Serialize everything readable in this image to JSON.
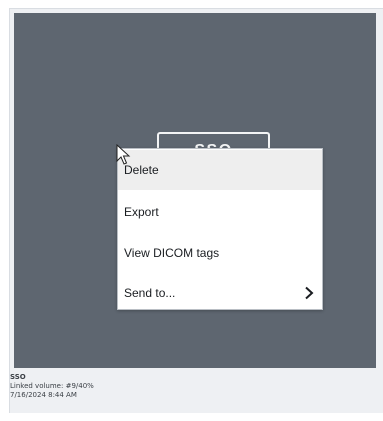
{
  "thumbnail": {
    "label": "SSO"
  },
  "meta": {
    "name": "SSO",
    "linked_volume": "Linked volume: #9/40%",
    "date": "7/16/2024 8:44 AM"
  },
  "context_menu": {
    "items": [
      {
        "label": "Delete",
        "hovered": true
      },
      {
        "label": "Export"
      },
      {
        "label": "View DICOM tags"
      },
      {
        "label": "Send to...",
        "has_submenu": true,
        "icon": "chevron-right-icon"
      }
    ]
  },
  "colors": {
    "thumbnail_bg": "#5e6670",
    "menu_bg": "#ffffff",
    "hover_bg": "#eeeeee"
  }
}
